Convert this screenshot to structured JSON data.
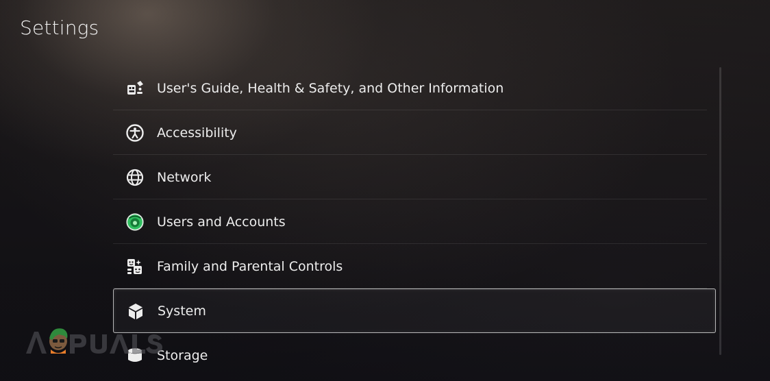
{
  "page": {
    "title": "Settings"
  },
  "menu": {
    "items": [
      {
        "label": "User's Guide, Health & Safety, and Other Information",
        "icon": "guide-icon"
      },
      {
        "label": "Accessibility",
        "icon": "accessibility-icon"
      },
      {
        "label": "Network",
        "icon": "globe-icon"
      },
      {
        "label": "Users and Accounts",
        "icon": "user-avatar-icon"
      },
      {
        "label": "Family and Parental Controls",
        "icon": "family-icon"
      },
      {
        "label": "System",
        "icon": "cube-icon"
      },
      {
        "label": "Storage",
        "icon": "storage-icon"
      }
    ],
    "selected_index": 5
  },
  "colors": {
    "text": "#ececec",
    "selection_border": "#e6e6e6",
    "avatar_green": "#2fbf5f"
  }
}
